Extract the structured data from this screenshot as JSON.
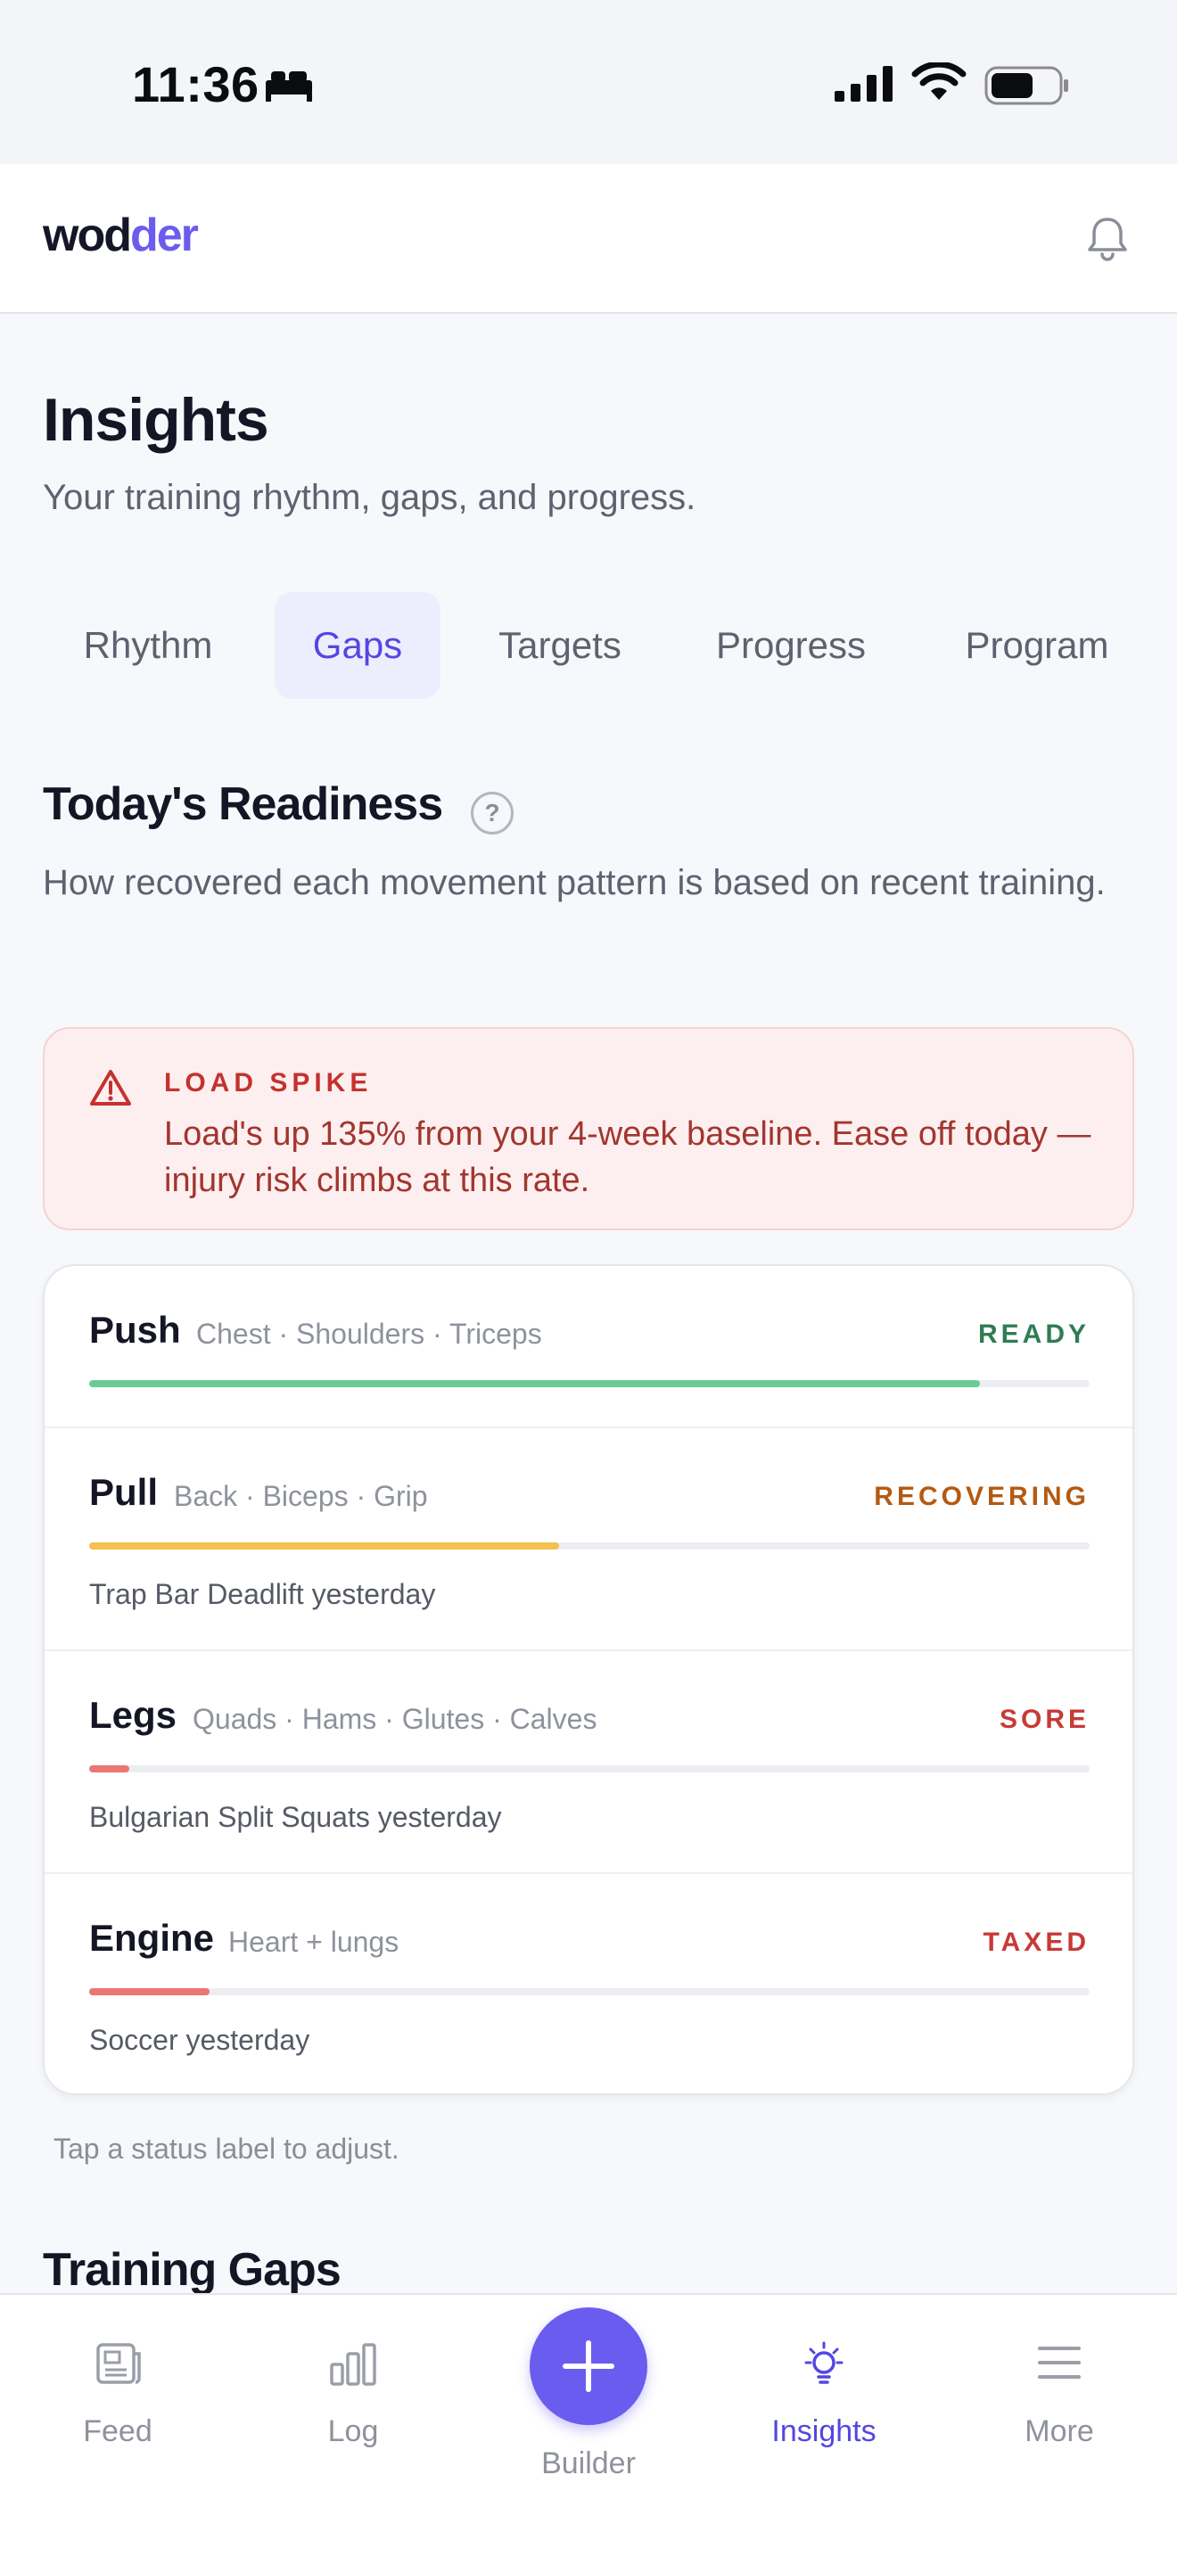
{
  "status_bar": {
    "time": "11:36"
  },
  "header": {
    "brand_part1": "wod",
    "brand_part2": "der"
  },
  "page": {
    "title": "Insights",
    "subtitle": "Your training rhythm, gaps, and progress."
  },
  "tabs": [
    {
      "label": "Rhythm",
      "active": false
    },
    {
      "label": "Gaps",
      "active": true
    },
    {
      "label": "Targets",
      "active": false
    },
    {
      "label": "Progress",
      "active": false
    },
    {
      "label": "Program",
      "active": false
    }
  ],
  "readiness": {
    "title": "Today's Readiness",
    "help": "?",
    "description": "How recovered each movement pattern is based on recent training.",
    "alert": {
      "title": "LOAD SPIKE",
      "text": "Load's up 135% from your 4-week baseline. Ease off today — injury risk climbs at this rate."
    },
    "patterns": [
      {
        "name": "Push",
        "muscles": "Chest · Shoulders · Triceps",
        "status": "READY",
        "status_color": "#2e7d53",
        "fill_color": "#6ccb95",
        "level": 0.89,
        "note": ""
      },
      {
        "name": "Pull",
        "muscles": "Back · Biceps · Grip",
        "status": "RECOVERING",
        "status_color": "#b45a12",
        "fill_color": "#f2c14e",
        "level": 0.47,
        "note": "Trap Bar Deadlift yesterday"
      },
      {
        "name": "Legs",
        "muscles": "Quads · Hams · Glutes · Calves",
        "status": "SORE",
        "status_color": "#c73a35",
        "fill_color": "#ea7773",
        "level": 0.04,
        "note": "Bulgarian Split Squats yesterday"
      },
      {
        "name": "Engine",
        "muscles": "Heart + lungs",
        "status": "TAXED",
        "status_color": "#c73a35",
        "fill_color": "#ea7773",
        "level": 0.12,
        "note": "Soccer yesterday"
      }
    ],
    "footnote": "Tap a status label to adjust."
  },
  "gaps": {
    "title": "Training Gaps"
  },
  "nav": {
    "feed": "Feed",
    "log": "Log",
    "builder": "Builder",
    "insights": "Insights",
    "more": "More",
    "active": "insights"
  },
  "colors": {
    "accent": "#6b5cf0",
    "alert_red": "#c4322f"
  }
}
